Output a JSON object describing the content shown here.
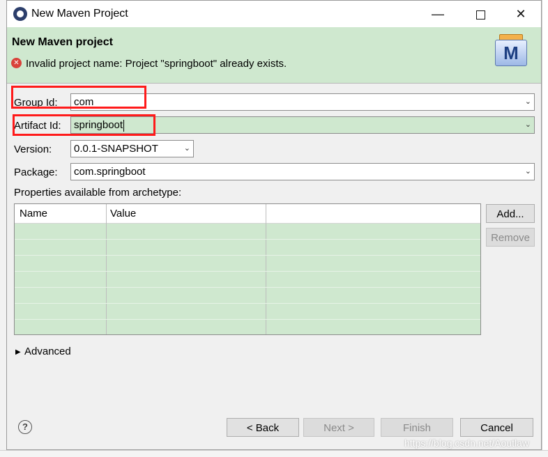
{
  "window": {
    "title": "New Maven Project"
  },
  "header": {
    "title": "New Maven project",
    "error_message": "Invalid project name: Project \"springboot\" already exists.",
    "logo_letter": "M"
  },
  "form": {
    "group_id": {
      "label": "Group Id:",
      "value": "com"
    },
    "artifact_id": {
      "label": "Artifact Id:",
      "value": "springboot"
    },
    "version": {
      "label": "Version:",
      "value": "0.0.1-SNAPSHOT"
    },
    "package": {
      "label": "Package:",
      "value": "com.springboot"
    }
  },
  "properties": {
    "label": "Properties available from archetype:",
    "columns": [
      "Name",
      "Value"
    ],
    "rows": []
  },
  "side_buttons": {
    "add": "Add...",
    "remove": "Remove"
  },
  "advanced": {
    "label": "Advanced"
  },
  "footer": {
    "back": "< Back",
    "next": "Next >",
    "finish": "Finish",
    "cancel": "Cancel"
  },
  "watermark": "https://blog.csdn.net/Aoutlaw",
  "icons": [
    "app-icon",
    "minimize-icon",
    "maximize-icon",
    "close-icon",
    "error-icon",
    "maven-logo-icon",
    "chevron-down-icon",
    "expand-arrow-icon",
    "help-icon"
  ],
  "colors": {
    "accent_green": "#cfe8cf",
    "error_red": "#d9413a",
    "highlight_red": "#ff1a1a"
  }
}
